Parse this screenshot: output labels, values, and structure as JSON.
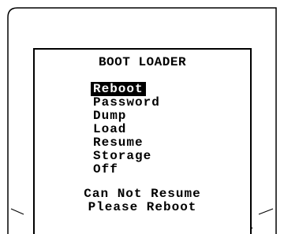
{
  "screen": {
    "title": "BOOT LOADER",
    "menu": [
      {
        "label": "Reboot",
        "selected": true
      },
      {
        "label": "Password",
        "selected": false
      },
      {
        "label": "Dump",
        "selected": false
      },
      {
        "label": "Load",
        "selected": false
      },
      {
        "label": "Resume",
        "selected": false
      },
      {
        "label": "Storage",
        "selected": false
      },
      {
        "label": "Off",
        "selected": false
      }
    ],
    "status_lines": [
      "Can Not Resume",
      "Please Reboot"
    ]
  },
  "colors": {
    "foreground": "#000000",
    "background": "#ffffff",
    "selection_bg": "#000000",
    "selection_fg": "#ffffff"
  }
}
